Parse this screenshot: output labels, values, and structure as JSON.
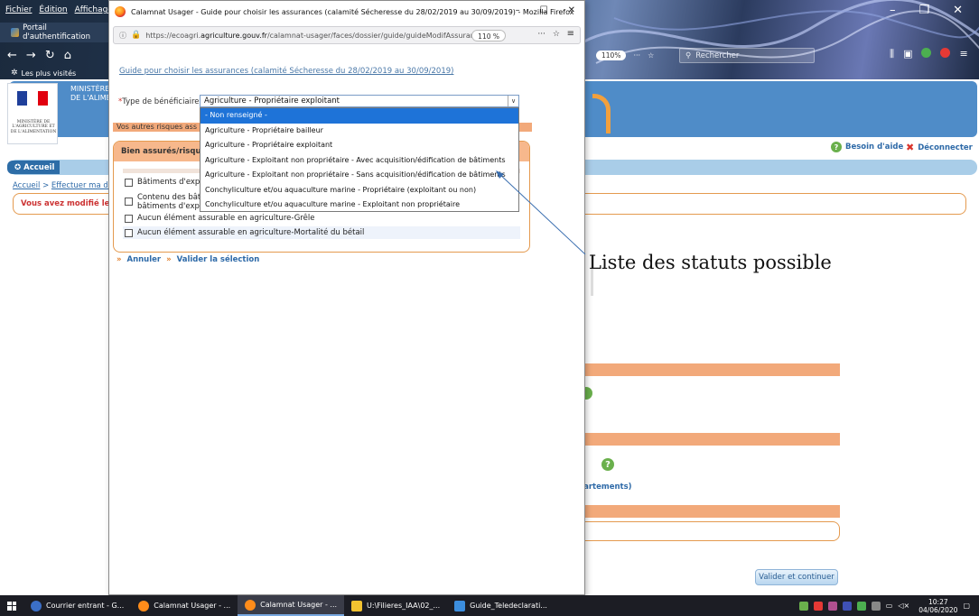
{
  "background_browser": {
    "menu": [
      "Fichier",
      "Édition",
      "Affichage",
      "H"
    ],
    "tab_title": "Portail d'authentification",
    "bookmark": "Les plus visités",
    "zoom": "110%",
    "search_placeholder": "Rechercher",
    "ministry_line1": "MINISTÈRE",
    "ministry_line2": "DE L'ALIME",
    "logo_caption": "MINISTÈRE DE L'AGRICULTURE ET DE L'ALIMENTATION",
    "help_label": "Besoin d'aide",
    "logout_label": "Déconnecter",
    "home_tab": "Accueil",
    "breadcrumb_home": "Accueil",
    "breadcrumb_sep": ">",
    "breadcrumb_current": "Effectuer ma de",
    "warning": "Vous avez modifié les",
    "dept_link": "partements)",
    "validate_button": "Valider et continuer"
  },
  "popup": {
    "window_title": "Calamnat Usager - Guide pour choisir les assurances (calamité Sécheresse du 28/02/2019 au 30/09/2019) - Mozilla Firefox",
    "url_prefix": "https://ecoagri.",
    "url_host": "agriculture.gouv.fr",
    "url_path": "/calamnat-usager/faces/dossier/guide/guideModifAssurance",
    "zoom": "110 %",
    "guide_link": "Guide pour choisir les assurances (calamité Sécheresse du 28/02/2019 au 30/09/2019)",
    "required_mark": "*",
    "field_label": "Type de bénéficiaire:",
    "selected_value": "Agriculture - Propriétaire exploitant",
    "options": [
      "- Non renseigné -",
      "Agriculture - Propriétaire bailleur",
      "Agriculture - Propriétaire exploitant",
      "Agriculture - Exploitant non propriétaire - Avec acquisition/édification de bâtiments",
      "Agriculture - Exploitant non propriétaire - Sans acquisition/édification de bâtiments",
      "Conchyliculture et/ou aquaculture marine - Propriétaire (exploitant ou non)",
      "Conchyliculture et/ou aquaculture marine - Exploitant non propriétaire"
    ],
    "highlighted_option_index": 0,
    "other_risks": "Vos autres risques ass",
    "panel_title": "Bien assurés/risque",
    "checkboxes": [
      "Bâtiments d'expl",
      "Contenu des bât",
      "bâtiments d'expl",
      "Aucun élément assurable en agriculture-Grêle",
      "Aucun élément assurable en agriculture-Mortalité du bétail"
    ],
    "cancel": "Annuler",
    "validate_selection": "Valider la sélection"
  },
  "annotation": {
    "text": "Liste des statuts possible"
  },
  "taskbar": {
    "items": [
      {
        "label": "Courrier entrant - G...",
        "color": "#3b6fc7"
      },
      {
        "label": "Calamnat Usager - ...",
        "color": "#ff8c1a"
      },
      {
        "label": "Calamnat Usager - ...",
        "color": "#ff8c1a"
      },
      {
        "label": "U:\\Filieres_IAA\\02_...",
        "color": "#f2c230"
      },
      {
        "label": "Guide_Teledeclarati...",
        "color": "#3c8ede"
      }
    ],
    "active_index": 2,
    "time": "10:27",
    "date": "04/06/2020"
  },
  "colors": {
    "accent_orange": "#f2a97a",
    "header_blue": "#4f8cc8",
    "link_blue": "#2e6aa8",
    "selection_blue": "#1e73d8"
  }
}
